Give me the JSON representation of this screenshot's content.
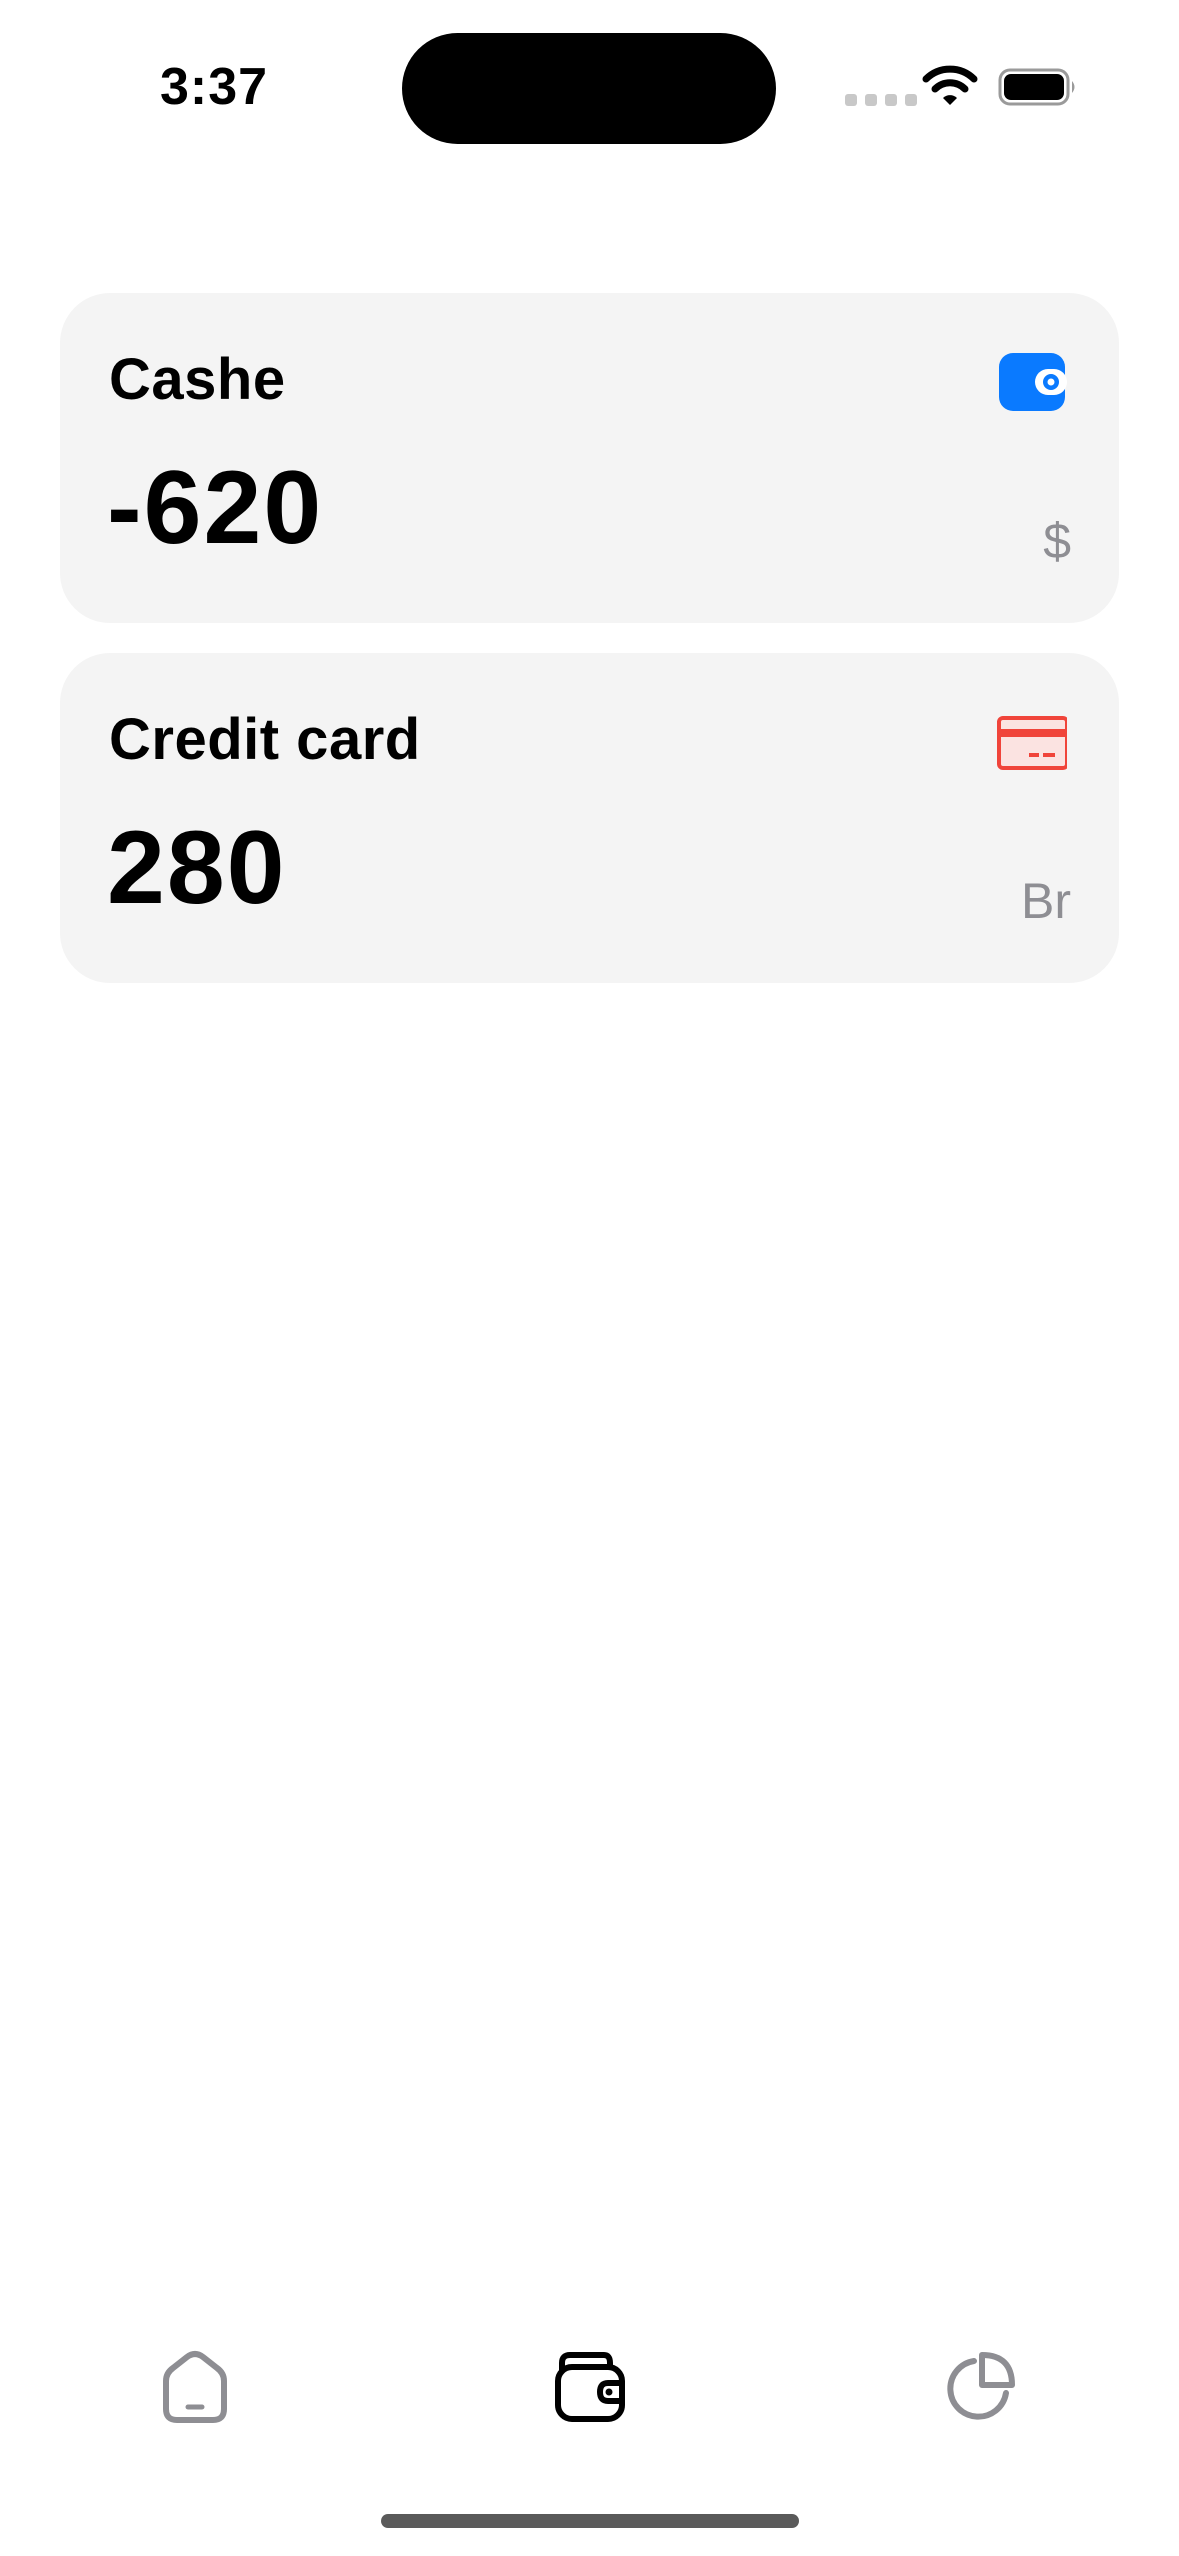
{
  "status_bar": {
    "time": "3:37"
  },
  "accounts": [
    {
      "name": "Cashe",
      "amount": "-620",
      "currency": "$",
      "icon": "wallet-icon",
      "icon_color": "#0a7aff"
    },
    {
      "name": "Credit card",
      "amount": "280",
      "currency": "Br",
      "icon": "credit-card-icon",
      "icon_color": "#f0443a"
    }
  ],
  "tab_bar": {
    "tabs": [
      {
        "icon": "home-icon",
        "active": false
      },
      {
        "icon": "wallet-icon",
        "active": true
      },
      {
        "icon": "pie-chart-icon",
        "active": false
      }
    ],
    "active_color": "#000000",
    "inactive_color": "#8e8e93"
  }
}
